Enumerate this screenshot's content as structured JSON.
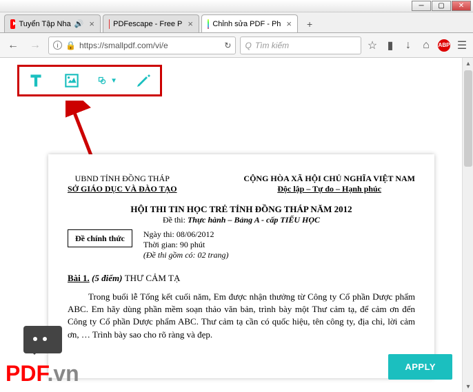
{
  "tabs": [
    {
      "label": "Tuyển Tập Nha"
    },
    {
      "label": "PDFescape - Free P"
    },
    {
      "label": "Chỉnh sửa PDF - Ph"
    }
  ],
  "url": "https://smallpdf.com/vi/e",
  "search_placeholder": "Tìm kiếm",
  "apply_label": "APPLY",
  "watermark": {
    "p1": "PDF",
    "p2": ".vn"
  },
  "doc": {
    "header_left_1": "UBND TỈNH ĐỒNG THÁP",
    "header_left_2": "SỞ GIÁO DỤC VÀ ĐÀO TẠO",
    "header_right_1": "CỘNG HÒA XÃ HỘI CHỦ NGHĨA VIỆT NAM",
    "header_right_2": "Độc lập – Tự do – Hạnh phúc",
    "title_1": "HỘI THI TIN HỌC TRẺ TỈNH ĐỒNG THÁP  NĂM 2012",
    "title_2_pre": "Đề thi: ",
    "title_2_em": "Thực hành – Bảng A - cấp  TIỂU HỌC",
    "exam_box": "Đề chính thức",
    "info_1": "Ngày thi: 08/06/2012",
    "info_2": "Thời gian: 90 phút",
    "info_3": "(Đề thi gồm có: 02 trang)",
    "bai_label": "Bài 1.",
    "bai_points": " (5 điểm) ",
    "bai_title": "THƯ CẢM TẠ",
    "body": "Trong buổi lễ Tổng kết cuối năm, Em được nhận thưởng từ Công ty Cổ phần Dược phẩm ABC. Em hãy dùng phần mềm soạn thảo văn bản, trình bày một Thư cảm tạ, để cảm ơn đến Công ty Cổ phần Dược phẩm ABC. Thư cảm tạ cần có quốc hiệu, tên công ty, địa chỉ, lời cảm ơn, … Trình bày sao cho rõ ràng và đẹp."
  }
}
